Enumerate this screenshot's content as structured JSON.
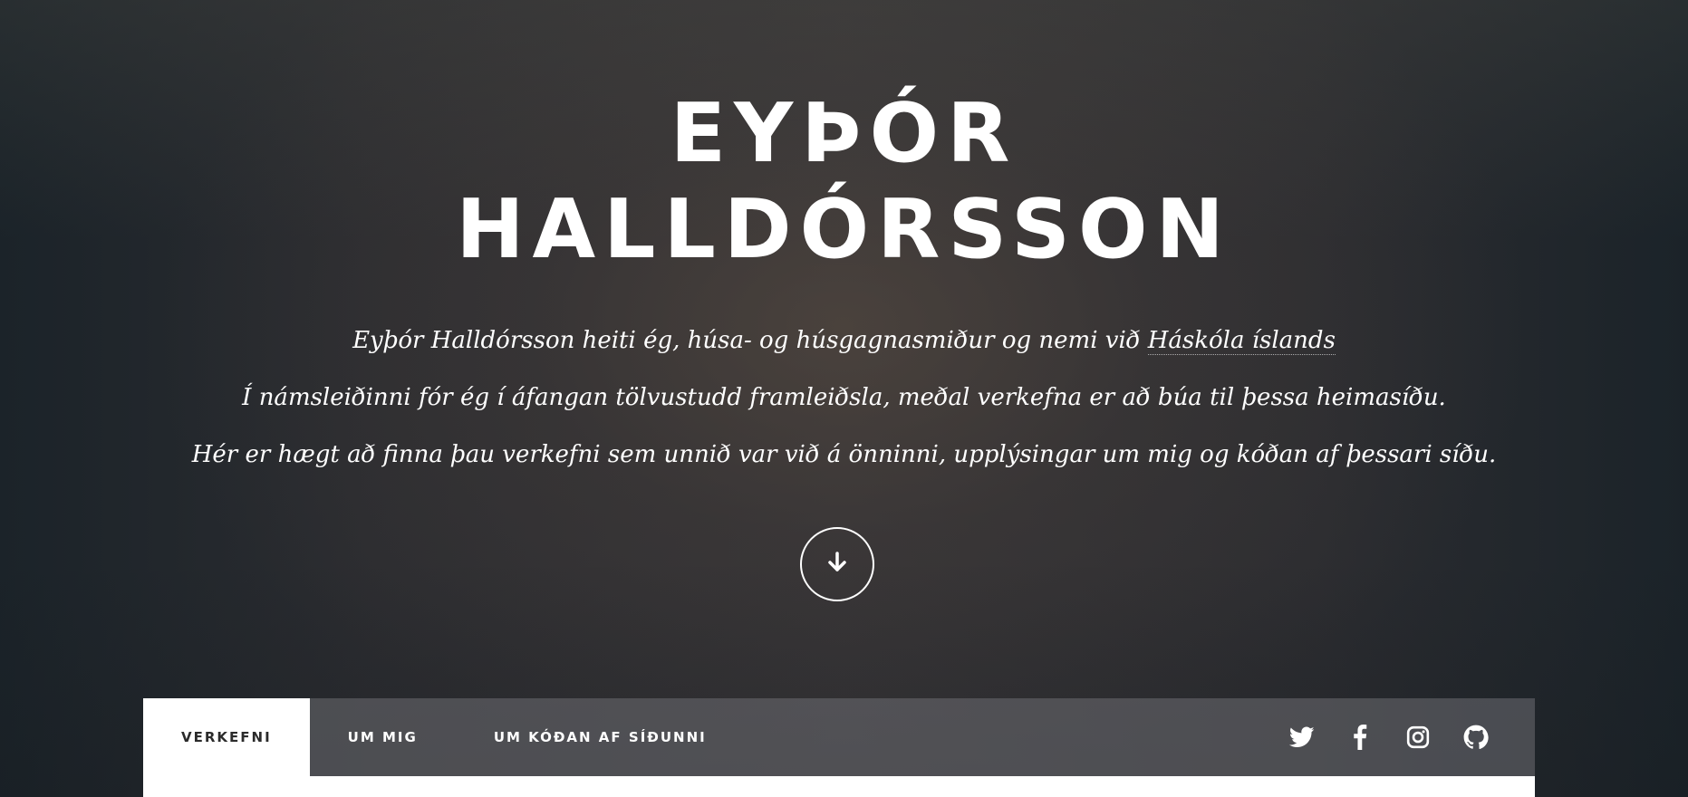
{
  "header": {
    "title_line1": "Eyþór",
    "title_line2": "Halldórsson",
    "intro": {
      "line1_before_link": "Eyþór Halldórsson heiti ég, húsa- og húsgagnasmiður og nemi við ",
      "line1_link": "Háskóla íslands",
      "line2": "Í námsleiðinni fór ég í áfangan tölvustudd framleiðsla, meðal verkefna er að búa til þessa heimasíðu.",
      "line3": "Hér er hægt að finna þau verkefni sem unnið var við á önninni, upplýsingar um mig og kóðan af þessari síðu."
    },
    "scroll_icon": "arrow-down-icon"
  },
  "nav": {
    "items": [
      {
        "label": "VERKEFNI",
        "active": true
      },
      {
        "label": "UM MIG",
        "active": false
      },
      {
        "label": "UM KÓÐAN AF SÍÐUNNI",
        "active": false
      }
    ],
    "social": [
      "twitter-icon",
      "facebook-icon",
      "instagram-icon",
      "github-icon"
    ]
  },
  "colors": {
    "text": "#ffffff",
    "nav_background": "#5c5c60",
    "active_tab_background": "#ffffff",
    "active_tab_text": "#2b2b2b"
  }
}
